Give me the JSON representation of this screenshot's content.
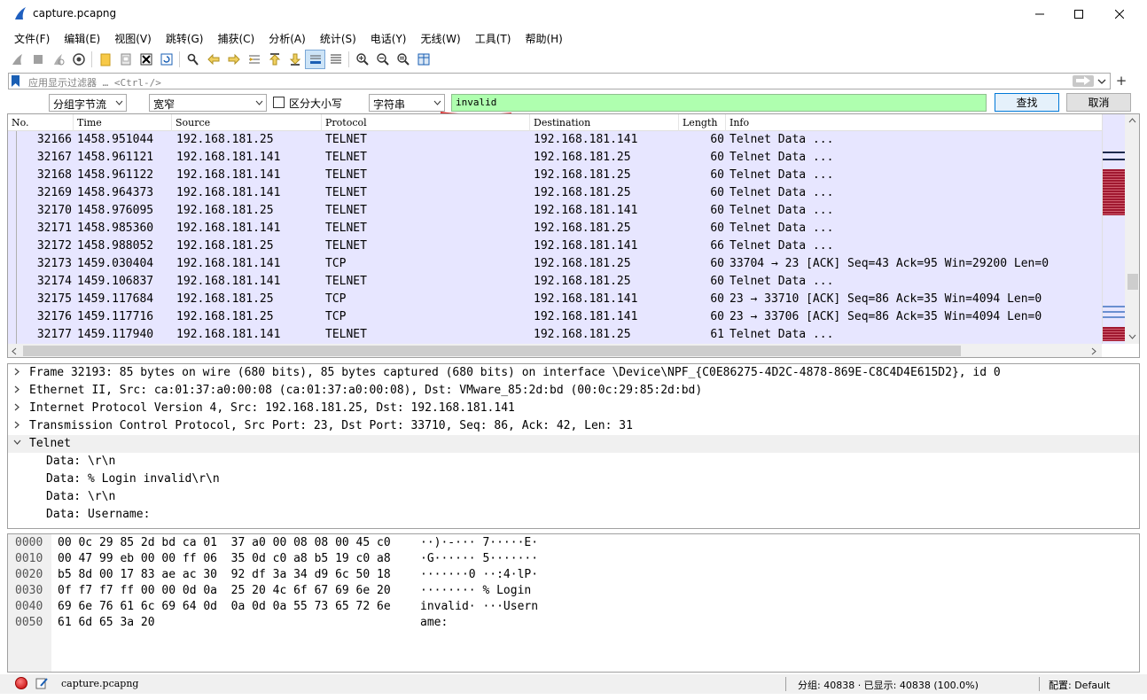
{
  "window": {
    "title": "capture.pcapng"
  },
  "menu": [
    "文件(F)",
    "编辑(E)",
    "视图(V)",
    "跳转(G)",
    "捕获(C)",
    "分析(A)",
    "统计(S)",
    "电话(Y)",
    "无线(W)",
    "工具(T)",
    "帮助(H)"
  ],
  "filter": {
    "placeholder": "应用显示过滤器 … <Ctrl-/>"
  },
  "find": {
    "search_in": "分组字节流",
    "char_width": "宽窄",
    "case_sensitive_label": "区分大小写",
    "case_sensitive": false,
    "type": "字符串",
    "text": "invalid",
    "find_label": "查找",
    "cancel_label": "取消"
  },
  "packet_list": {
    "columns": [
      "No.",
      "Time",
      "Source",
      "Protocol",
      "Destination",
      "Length",
      "Info"
    ],
    "rows": [
      {
        "no": "32166",
        "time": "1458.951044",
        "src": "192.168.181.25",
        "proto": "TELNET",
        "dst": "192.168.181.141",
        "len": "60",
        "info": "Telnet Data ..."
      },
      {
        "no": "32167",
        "time": "1458.961121",
        "src": "192.168.181.141",
        "proto": "TELNET",
        "dst": "192.168.181.25",
        "len": "60",
        "info": "Telnet Data ..."
      },
      {
        "no": "32168",
        "time": "1458.961122",
        "src": "192.168.181.141",
        "proto": "TELNET",
        "dst": "192.168.181.25",
        "len": "60",
        "info": "Telnet Data ..."
      },
      {
        "no": "32169",
        "time": "1458.964373",
        "src": "192.168.181.141",
        "proto": "TELNET",
        "dst": "192.168.181.25",
        "len": "60",
        "info": "Telnet Data ..."
      },
      {
        "no": "32170",
        "time": "1458.976095",
        "src": "192.168.181.25",
        "proto": "TELNET",
        "dst": "192.168.181.141",
        "len": "60",
        "info": "Telnet Data ..."
      },
      {
        "no": "32171",
        "time": "1458.985360",
        "src": "192.168.181.141",
        "proto": "TELNET",
        "dst": "192.168.181.25",
        "len": "60",
        "info": "Telnet Data ..."
      },
      {
        "no": "32172",
        "time": "1458.988052",
        "src": "192.168.181.25",
        "proto": "TELNET",
        "dst": "192.168.181.141",
        "len": "66",
        "info": "Telnet Data ..."
      },
      {
        "no": "32173",
        "time": "1459.030404",
        "src": "192.168.181.141",
        "proto": "TCP",
        "dst": "192.168.181.25",
        "len": "60",
        "info": "33704 → 23 [ACK] Seq=43 Ack=95 Win=29200 Len=0"
      },
      {
        "no": "32174",
        "time": "1459.106837",
        "src": "192.168.181.141",
        "proto": "TELNET",
        "dst": "192.168.181.25",
        "len": "60",
        "info": "Telnet Data ..."
      },
      {
        "no": "32175",
        "time": "1459.117684",
        "src": "192.168.181.25",
        "proto": "TCP",
        "dst": "192.168.181.141",
        "len": "60",
        "info": "23 → 33710 [ACK] Seq=86 Ack=35 Win=4094 Len=0"
      },
      {
        "no": "32176",
        "time": "1459.117716",
        "src": "192.168.181.25",
        "proto": "TCP",
        "dst": "192.168.181.141",
        "len": "60",
        "info": "23 → 33706 [ACK] Seq=86 Ack=35 Win=4094 Len=0"
      },
      {
        "no": "32177",
        "time": "1459.117940",
        "src": "192.168.181.141",
        "proto": "TELNET",
        "dst": "192.168.181.25",
        "len": "61",
        "info": "Telnet Data ..."
      }
    ]
  },
  "details": [
    {
      "text": "Frame 32193: 85 bytes on wire (680 bits), 85 bytes captured (680 bits) on interface \\Device\\NPF_{C0E86275-4D2C-4878-869E-C8C4D4E615D2}, id 0",
      "expanded": false,
      "level": 0
    },
    {
      "text": "Ethernet II, Src: ca:01:37:a0:00:08 (ca:01:37:a0:00:08), Dst: VMware_85:2d:bd (00:0c:29:85:2d:bd)",
      "expanded": false,
      "level": 0
    },
    {
      "text": "Internet Protocol Version 4, Src: 192.168.181.25, Dst: 192.168.181.141",
      "expanded": false,
      "level": 0
    },
    {
      "text": "Transmission Control Protocol, Src Port: 23, Dst Port: 33710, Seq: 86, Ack: 42, Len: 31",
      "expanded": false,
      "level": 0
    },
    {
      "text": "Telnet",
      "expanded": true,
      "level": 0
    },
    {
      "text": "Data: \\r\\n",
      "level": 1
    },
    {
      "text": "Data: % Login invalid\\r\\n",
      "level": 1
    },
    {
      "text": "Data: \\r\\n",
      "level": 1
    },
    {
      "text": "Data: Username: ",
      "level": 1
    }
  ],
  "bytes": [
    {
      "off": "0000",
      "hex": "00 0c 29 85 2d bd ca 01  37 a0 00 08 08 00 45 c0",
      "ascii": "··)·-··· 7·····E·"
    },
    {
      "off": "0010",
      "hex": "00 47 99 eb 00 00 ff 06  35 0d c0 a8 b5 19 c0 a8",
      "ascii": "·G······ 5·······"
    },
    {
      "off": "0020",
      "hex": "b5 8d 00 17 83 ae ac 30  92 df 3a 34 d9 6c 50 18",
      "ascii": "·······0 ··:4·lP·"
    },
    {
      "off": "0030",
      "hex": "0f f7 f7 ff 00 00 0d 0a  25 20 4c 6f 67 69 6e 20",
      "ascii": "········ % Login "
    },
    {
      "off": "0040",
      "hex": "69 6e 76 61 6c 69 64 0d  0a 0d 0a 55 73 65 72 6e",
      "ascii": "invalid· ···Usern"
    },
    {
      "off": "0050",
      "hex": "61 6d 65 3a 20",
      "ascii": "ame: "
    }
  ],
  "status": {
    "file": "capture.pcapng",
    "packets": "分组: 40838 · 已显示: 40838 (100.0%)",
    "profile": "配置: Default"
  },
  "colors": {
    "telnet_row": "#e7e6ff",
    "search_ok": "#afffaf",
    "minimap_mark": "#a01830"
  }
}
